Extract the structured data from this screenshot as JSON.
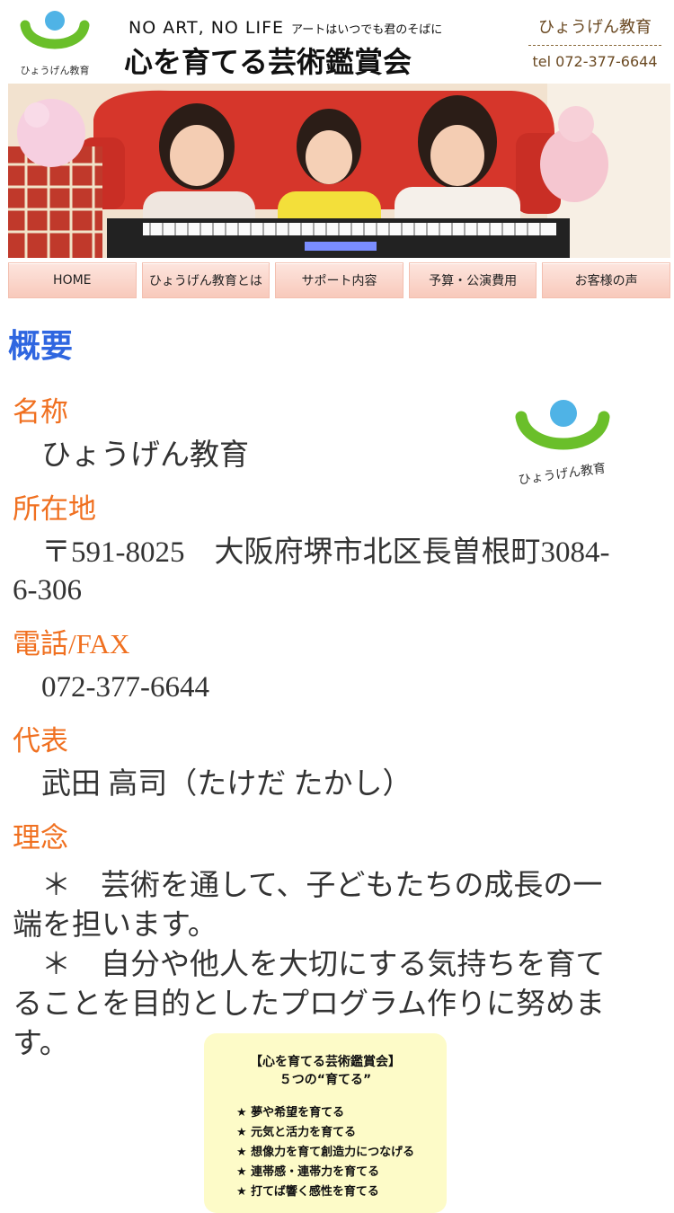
{
  "header": {
    "tagline": "NO ART, NO LIFE",
    "tagline_sub": "アートはいつでも君のそばに",
    "title": "心を育てる芸術鑑賞会",
    "brand_name": "ひょうげん教育",
    "brand_tel": "tel 072-377-6644",
    "logo_text": "ひょうげん教育"
  },
  "nav": [
    "HOME",
    "ひょうげん教育とは",
    "サポート内容",
    "予算・公演費用",
    "お客様の声"
  ],
  "section_title": "概要",
  "info": {
    "name_label": "名称",
    "name_value": "ひょうげん教育",
    "address_label": "所在地",
    "address_value": "〒591-8025　大阪府堺市北区長曽根町3084-6-306",
    "phone_label": "電話/FAX",
    "phone_value": "072-377-6644",
    "rep_label": "代表",
    "rep_value": "武田 高司（たけだ たかし）",
    "philosophy_label": "理念",
    "philosophy_1": "＊　芸術を通して、子どもたちの成長の一端を担います。",
    "philosophy_2": "＊　自分や他人を大切にする気持ちを育てることを目的としたプログラム作りに努めます。"
  },
  "box": {
    "title_1": "【心を育てる芸術鑑賞会】",
    "title_2": "５つの“育てる”",
    "items": [
      "★ 夢や希望を育てる",
      "★ 元気と活力を育てる",
      "★ 想像力を育て創造力につなげる",
      "★ 連帯感・連帯力を育てる",
      "★ 打てば響く感性を育てる"
    ]
  },
  "colors": {
    "accent_blue": "#2f66e0",
    "label_orange": "#f07020",
    "brand_brown": "#6b4a23",
    "logo_green": "#6abf2a",
    "logo_blue": "#4fb3e6"
  }
}
